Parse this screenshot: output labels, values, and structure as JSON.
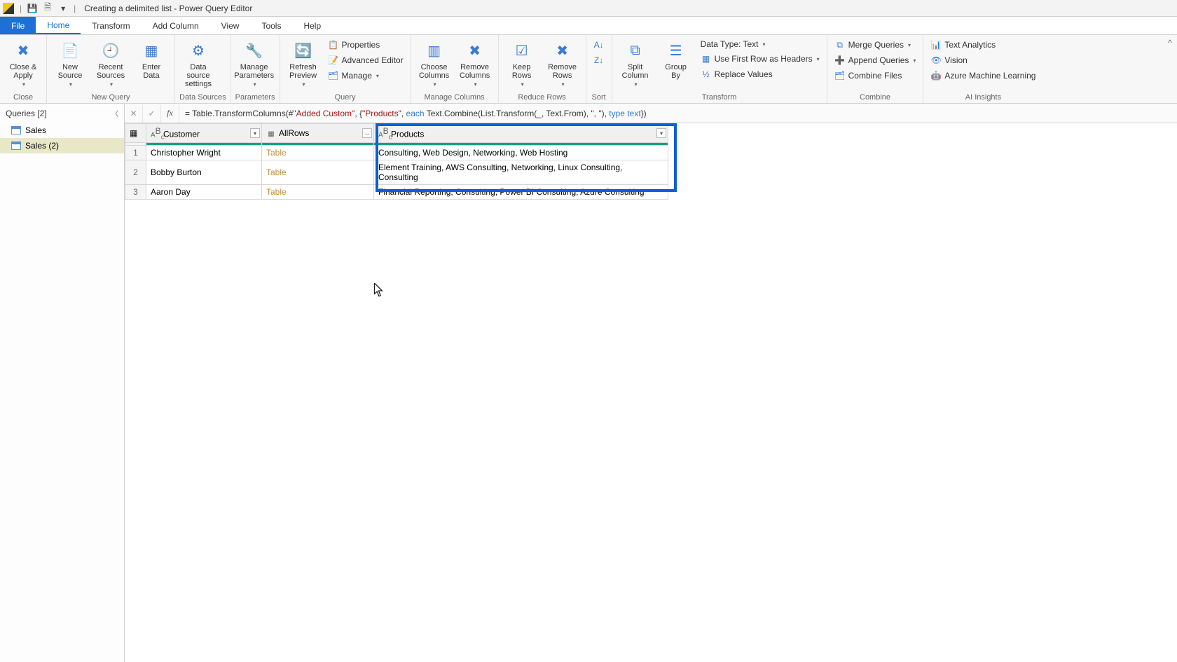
{
  "title": "Creating a delimited list - Power Query Editor",
  "menutabs": [
    "File",
    "Home",
    "Transform",
    "Add Column",
    "View",
    "Tools",
    "Help"
  ],
  "ribbon": {
    "close": {
      "close_apply": "Close &\nApply",
      "caption": "Close"
    },
    "newquery": {
      "new_source": "New\nSource",
      "recent_sources": "Recent\nSources",
      "enter_data": "Enter\nData",
      "caption": "New Query"
    },
    "datasources": {
      "data_source_settings": "Data source\nsettings",
      "caption": "Data Sources"
    },
    "parameters": {
      "manage_parameters": "Manage\nParameters",
      "caption": "Parameters"
    },
    "query": {
      "refresh_preview": "Refresh\nPreview",
      "properties": "Properties",
      "advanced_editor": "Advanced Editor",
      "manage": "Manage",
      "caption": "Query"
    },
    "managecols": {
      "choose_columns": "Choose\nColumns",
      "remove_columns": "Remove\nColumns",
      "caption": "Manage Columns"
    },
    "reducerows": {
      "keep_rows": "Keep\nRows",
      "remove_rows": "Remove\nRows",
      "caption": "Reduce Rows"
    },
    "sort": {
      "caption": "Sort"
    },
    "transform": {
      "split_column": "Split\nColumn",
      "group_by": "Group\nBy",
      "data_type": "Data Type: Text",
      "use_first_row": "Use First Row as Headers",
      "replace_values": "Replace Values",
      "caption": "Transform"
    },
    "combine": {
      "merge": "Merge Queries",
      "append": "Append Queries",
      "combine_files": "Combine Files",
      "caption": "Combine"
    },
    "ai": {
      "text_analytics": "Text Analytics",
      "vision": "Vision",
      "azure_ml": "Azure Machine Learning",
      "caption": "AI Insights"
    }
  },
  "queries": {
    "header": "Queries [2]",
    "items": [
      "Sales",
      "Sales (2)"
    ],
    "selected": 1
  },
  "formula": {
    "prefix": "= Table.TransformColumns(#",
    "str1": "\"Added Custom\"",
    "mid1": ", {",
    "str2": "\"Products\"",
    "mid2": ", ",
    "kw1": "each",
    "mid3": " Text.Combine(List.Transform(_, Text.From), ",
    "str3": "\", \"",
    "mid4": "), ",
    "kw2": "type",
    "sp": " ",
    "kw3": "text",
    "end": "})"
  },
  "columns": [
    "Customer",
    "AllRows",
    "Products"
  ],
  "rows": [
    {
      "n": "1",
      "customer": "Christopher Wright",
      "allrows": "Table",
      "products": "Consulting, Web Design, Networking, Web Hosting"
    },
    {
      "n": "2",
      "customer": "Bobby Burton",
      "allrows": "Table",
      "products": "Element Training, AWS Consulting, Networking, Linux Consulting, Consulting"
    },
    {
      "n": "3",
      "customer": "Aaron Day",
      "allrows": "Table",
      "products": "Financial Reporting, Consulting, Power BI Consulting, Azure Consulting"
    }
  ]
}
